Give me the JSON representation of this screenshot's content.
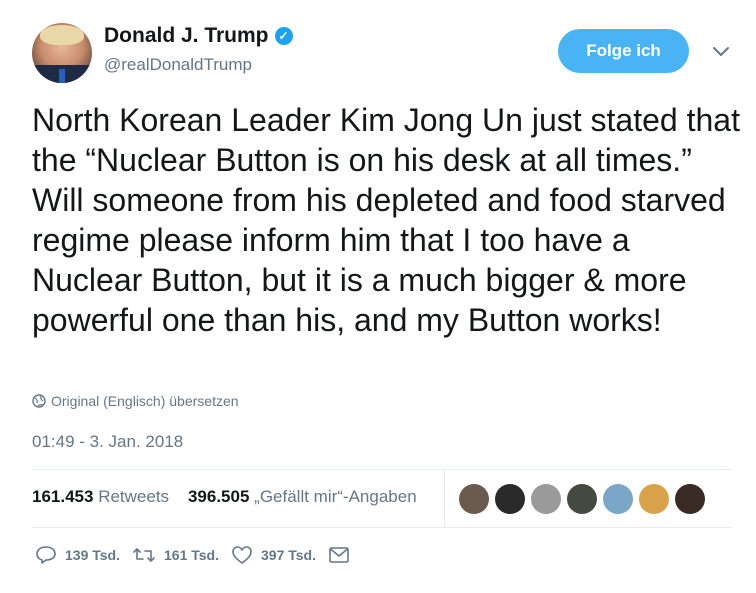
{
  "author": {
    "name": "Donald J. Trump",
    "handle": "@realDonaldTrump",
    "verified_icon": "verified-badge-icon"
  },
  "follow_button_label": "Folge ich",
  "tweet_text": "North Korean Leader Kim Jong Un just stated that the “Nuclear Button is on his desk at all times.” Will someone from his depleted and food starved regime please inform him that I too have a Nuclear Button, but it is a much bigger & more powerful one than his, and my Button works!",
  "translate_label": "Original (Englisch) übersetzen",
  "timestamp": "01:49 - 3. Jan. 2018",
  "stats": {
    "retweets_count": "161.453",
    "retweets_label": "Retweets",
    "likes_count": "396.505",
    "likes_label": "„Gefällt mir“-Angaben"
  },
  "likers": [
    {
      "color": "#6b5a4e"
    },
    {
      "color": "#2a2a2a"
    },
    {
      "color": "#9a9a9a"
    },
    {
      "color": "#444a40"
    },
    {
      "color": "#7aa6c8"
    },
    {
      "color": "#d7a24a"
    },
    {
      "color": "#3a2a24"
    }
  ],
  "actions": {
    "reply_count": "139 Tsd.",
    "retweet_count": "161 Tsd.",
    "like_count": "397 Tsd."
  },
  "colors": {
    "accent": "#4ab3f4",
    "secondary_text": "#657786",
    "divider": "#e6ecf0"
  }
}
